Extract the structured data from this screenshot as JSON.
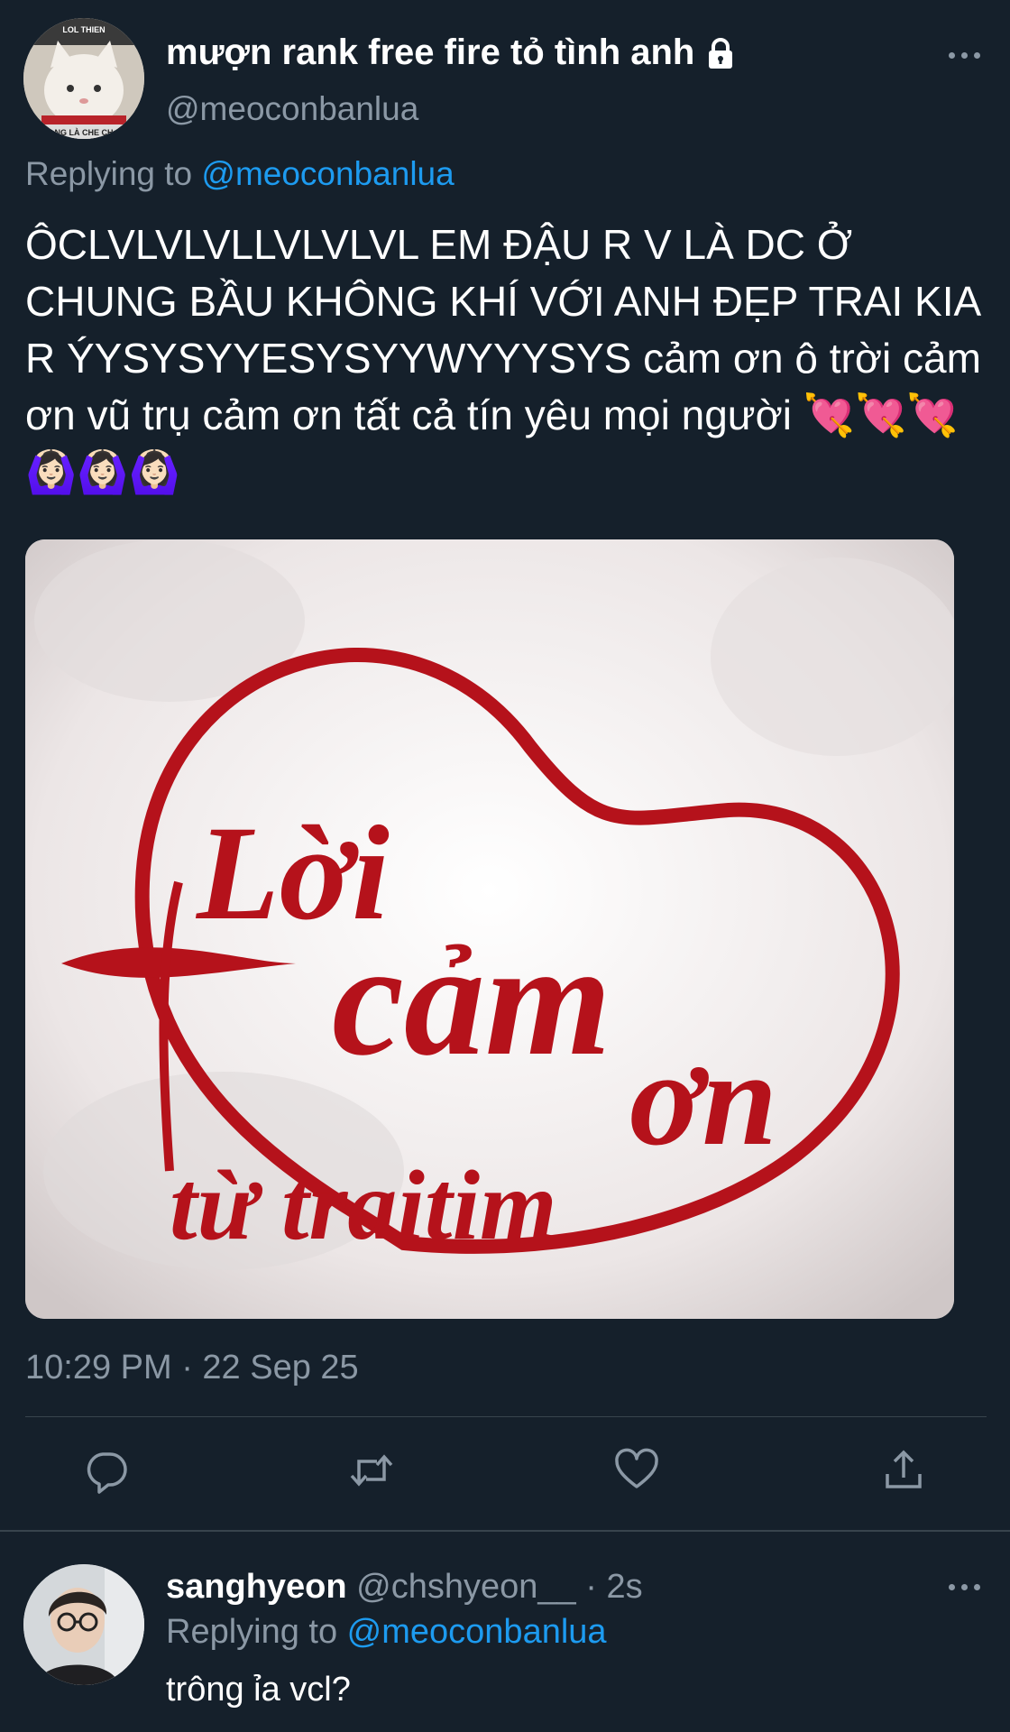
{
  "main_tweet": {
    "display_name": "mượn rank free fire tỏ tình anh",
    "handle": "@meoconbanlua",
    "replying_to_prefix": "Replying to ",
    "replying_to_handle": "@meoconbanlua",
    "text": "ÔCLVLVLVLLVLVLVL EM ĐẬU R V LÀ DC Ở CHUNG BẦU KHÔNG KHÍ VỚI ANH ĐẸP TRAI KIA R ÝYSYSYYESYSYYWYYYSYS cảm ơn ô trời cảm ơn vũ trụ cảm ơn tất cả tín yêu mọi người 💘💘💘🙆🏻‍♀️🙆🏻‍♀️🙆🏻‍♀️",
    "timestamp": "10:29 PM · 22 Sep 25",
    "image_text": {
      "line1": "Lời",
      "line2": "cảm",
      "line3": "ơn",
      "line4": "từ traitim"
    },
    "avatar_text": {
      "top": "LOL THIEN",
      "bottom": "NG LÀ CHE CH"
    }
  },
  "actions": [
    {
      "icon": "reply-icon"
    },
    {
      "icon": "retweet-icon"
    },
    {
      "icon": "like-icon"
    },
    {
      "icon": "share-icon"
    }
  ],
  "reply": {
    "display_name": "sanghyeon",
    "handle": "@chshyeon__",
    "separator": " · ",
    "time": "2s",
    "replying_to_prefix": "Replying to ",
    "replying_to_handle": "@meoconbanlua",
    "text": "trông ỉa vcl?"
  },
  "colors": {
    "background": "#15202b",
    "accent": "#1d9bf0",
    "secondary_text": "#8b98a5",
    "divider": "#38444d",
    "heart_red": "#b5121b"
  }
}
